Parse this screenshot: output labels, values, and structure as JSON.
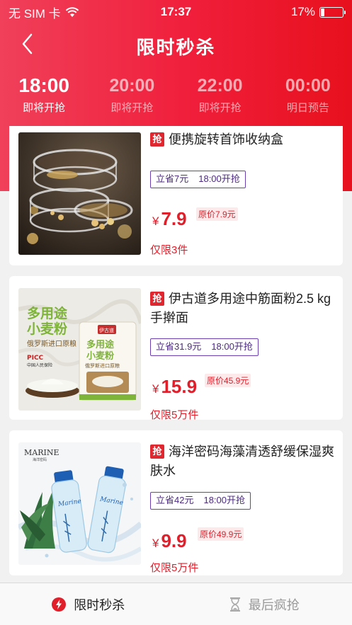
{
  "status_bar": {
    "carrier": "无 SIM 卡",
    "time": "17:37",
    "battery": "17%",
    "battery_level": 0.17
  },
  "header": {
    "title": "限时秒杀"
  },
  "time_tabs": [
    {
      "time": "18:00",
      "label": "即将开抢",
      "active": true
    },
    {
      "time": "20:00",
      "label": "即将开抢",
      "active": false
    },
    {
      "time": "22:00",
      "label": "即将开抢",
      "active": false
    },
    {
      "time": "00:00",
      "label": "明日预告",
      "active": false
    }
  ],
  "products": [
    {
      "badge": "抢",
      "title": "便携旋转首饰收纳盒",
      "save": "立省7元",
      "start": "18:00开抢",
      "currency": "¥",
      "price": "7.9",
      "original": "原价7.9元",
      "limit": "仅限3件",
      "image": "jewelry-box-image"
    },
    {
      "badge": "抢",
      "title": "伊古道多用途中筋面粉2.5 kg手擀面",
      "save": "立省31.9元",
      "start": "18:00开抢",
      "currency": "¥",
      "price": "15.9",
      "original": "原价45.9元",
      "limit": "仅限5万件",
      "image": "flour-bag-image",
      "image_text": {
        "line1": "多用途",
        "line2": "小麦粉",
        "line3": "俄罗斯进口原粮",
        "brand": "伊古道",
        "insurer": "PICC",
        "insurer_sub": "中国人民保险",
        "pack_line1": "多用途",
        "pack_line2": "小麦粉",
        "pack_line3": "俄罗斯进口原粮"
      }
    },
    {
      "badge": "抢",
      "title": "海洋密码海藻清透舒缓保湿爽肤水",
      "save": "立省42元",
      "start": "18:00开抢",
      "currency": "¥",
      "price": "9.9",
      "original": "原价49.9元",
      "limit": "仅限5万件",
      "image": "toner-bottles-image",
      "image_text": {
        "brand": "MARINE",
        "brand_sub": "海洋密码",
        "bottle_label": "Marine"
      }
    }
  ],
  "tab_bar": [
    {
      "label": "限时秒杀",
      "icon": "lightning-icon",
      "active": true
    },
    {
      "label": "最后疯抢",
      "icon": "hourglass-icon",
      "active": false
    }
  ],
  "colors": {
    "accent": "#e01f2b",
    "header_gradient_start": "#f0405a",
    "header_gradient_end": "#e7101d",
    "tag_border": "#6c3fb0"
  }
}
